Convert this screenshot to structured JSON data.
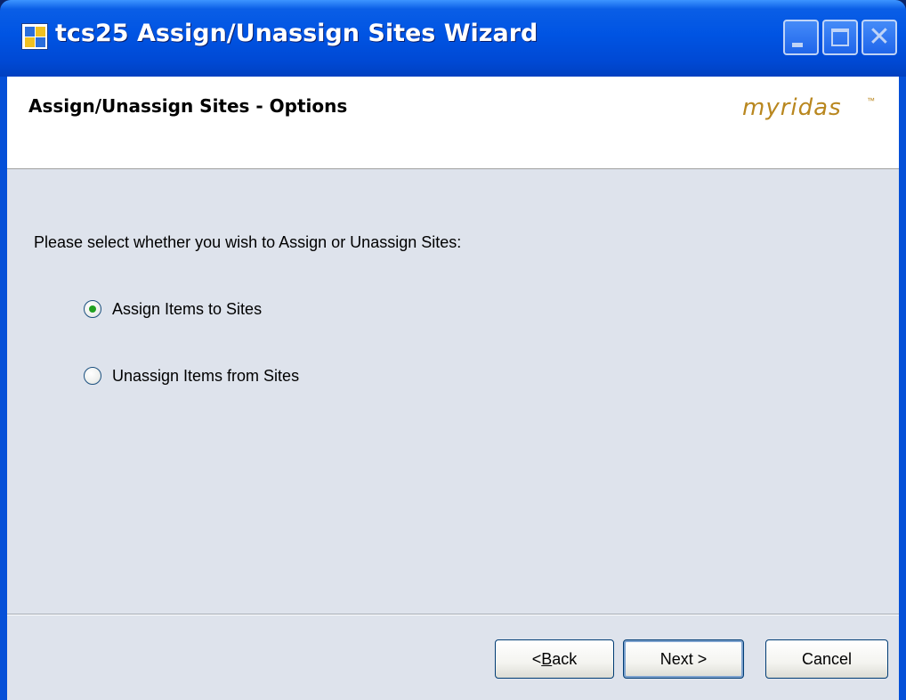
{
  "window": {
    "title": "tcs25 Assign/Unassign Sites Wizard",
    "app_icon": "wizard-app-icon",
    "controls": {
      "minimize_icon": "minimize-icon",
      "maximize_icon": "maximize-icon",
      "close_icon": "close-icon"
    }
  },
  "header": {
    "title": "Assign/Unassign Sites - Options",
    "brand": "myridas",
    "brand_mark": "™"
  },
  "body": {
    "prompt": "Please select whether you wish to Assign or Unassign Sites:",
    "options": [
      {
        "label": "Assign Items to Sites",
        "selected": true
      },
      {
        "label": "Unassign Items from Sites",
        "selected": false
      }
    ]
  },
  "footer": {
    "back_label_prefix": "< ",
    "back_label_key": "B",
    "back_label_rest": "ack",
    "next_label": "Next >",
    "cancel_label": "Cancel"
  },
  "colors": {
    "titlebar": "#0054e3",
    "body_bg": "#dee3ec",
    "brand": "#b9871f",
    "radio_dot": "#21a121"
  }
}
